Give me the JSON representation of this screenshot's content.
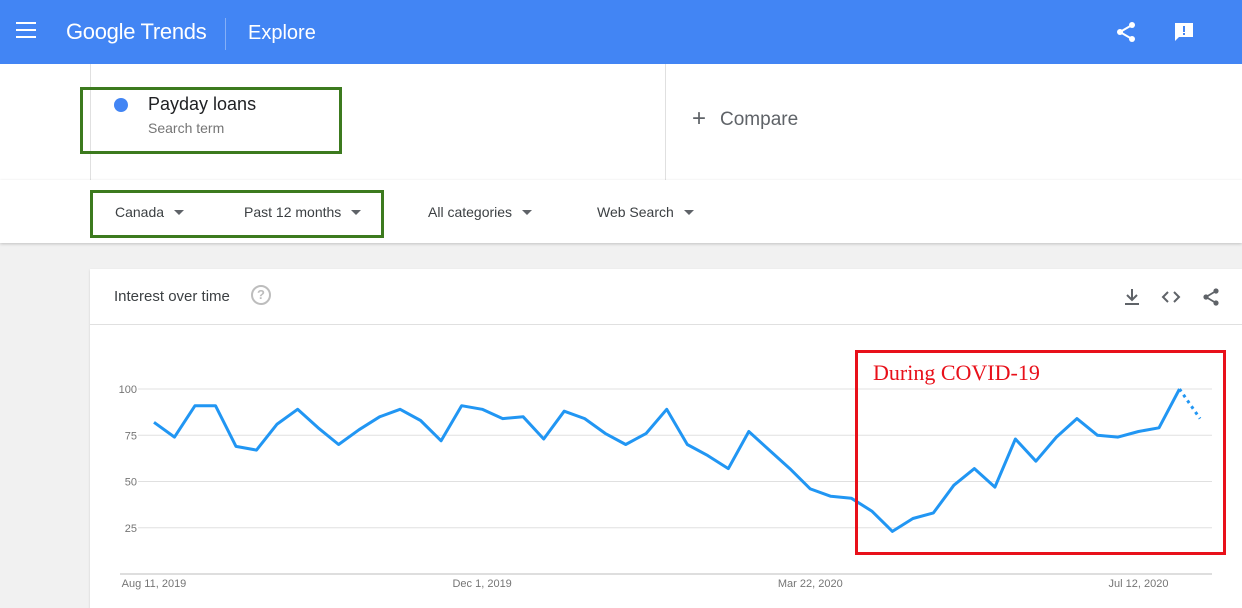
{
  "header": {
    "app_name": "Google Trends",
    "page_title": "Explore",
    "icons": [
      "menu-icon",
      "share-icon",
      "feedback-icon"
    ],
    "accent_color": "#4285f4"
  },
  "search_term": {
    "name": "Payday loans",
    "type_label": "Search term",
    "color": "#4285f4"
  },
  "compare": {
    "label": "Compare"
  },
  "filters": {
    "region": "Canada",
    "time_range": "Past 12 months",
    "category": "All categories",
    "search_type": "Web Search"
  },
  "card": {
    "title": "Interest over time",
    "icons": [
      "help-icon",
      "download-icon",
      "embed-icon",
      "share-icon"
    ]
  },
  "annotation": {
    "text": "During COVID-19",
    "color": "#e8101a"
  },
  "chart_data": {
    "type": "line",
    "y_ticks": [
      "100",
      "75",
      "50",
      "25"
    ],
    "ylim": [
      0,
      100
    ],
    "x_tick_labels": [
      "Aug 11, 2019",
      "Dec 1, 2019",
      "Mar 22, 2020",
      "Jul 12, 2020"
    ],
    "grid": true,
    "line_color": "#2196f3",
    "series": [
      {
        "values": [
          82,
          74,
          91,
          91,
          69,
          67,
          81,
          89,
          79,
          70,
          78,
          85,
          89,
          83,
          72,
          91,
          89,
          84,
          85,
          73,
          88,
          84,
          76,
          70,
          76,
          89,
          70,
          64,
          57,
          77,
          67,
          57,
          46,
          42,
          41,
          34,
          23,
          30,
          33,
          48,
          57,
          47,
          73,
          61,
          74,
          84,
          75,
          74,
          77,
          79,
          100,
          84
        ],
        "partial_last_points": 2
      }
    ]
  }
}
